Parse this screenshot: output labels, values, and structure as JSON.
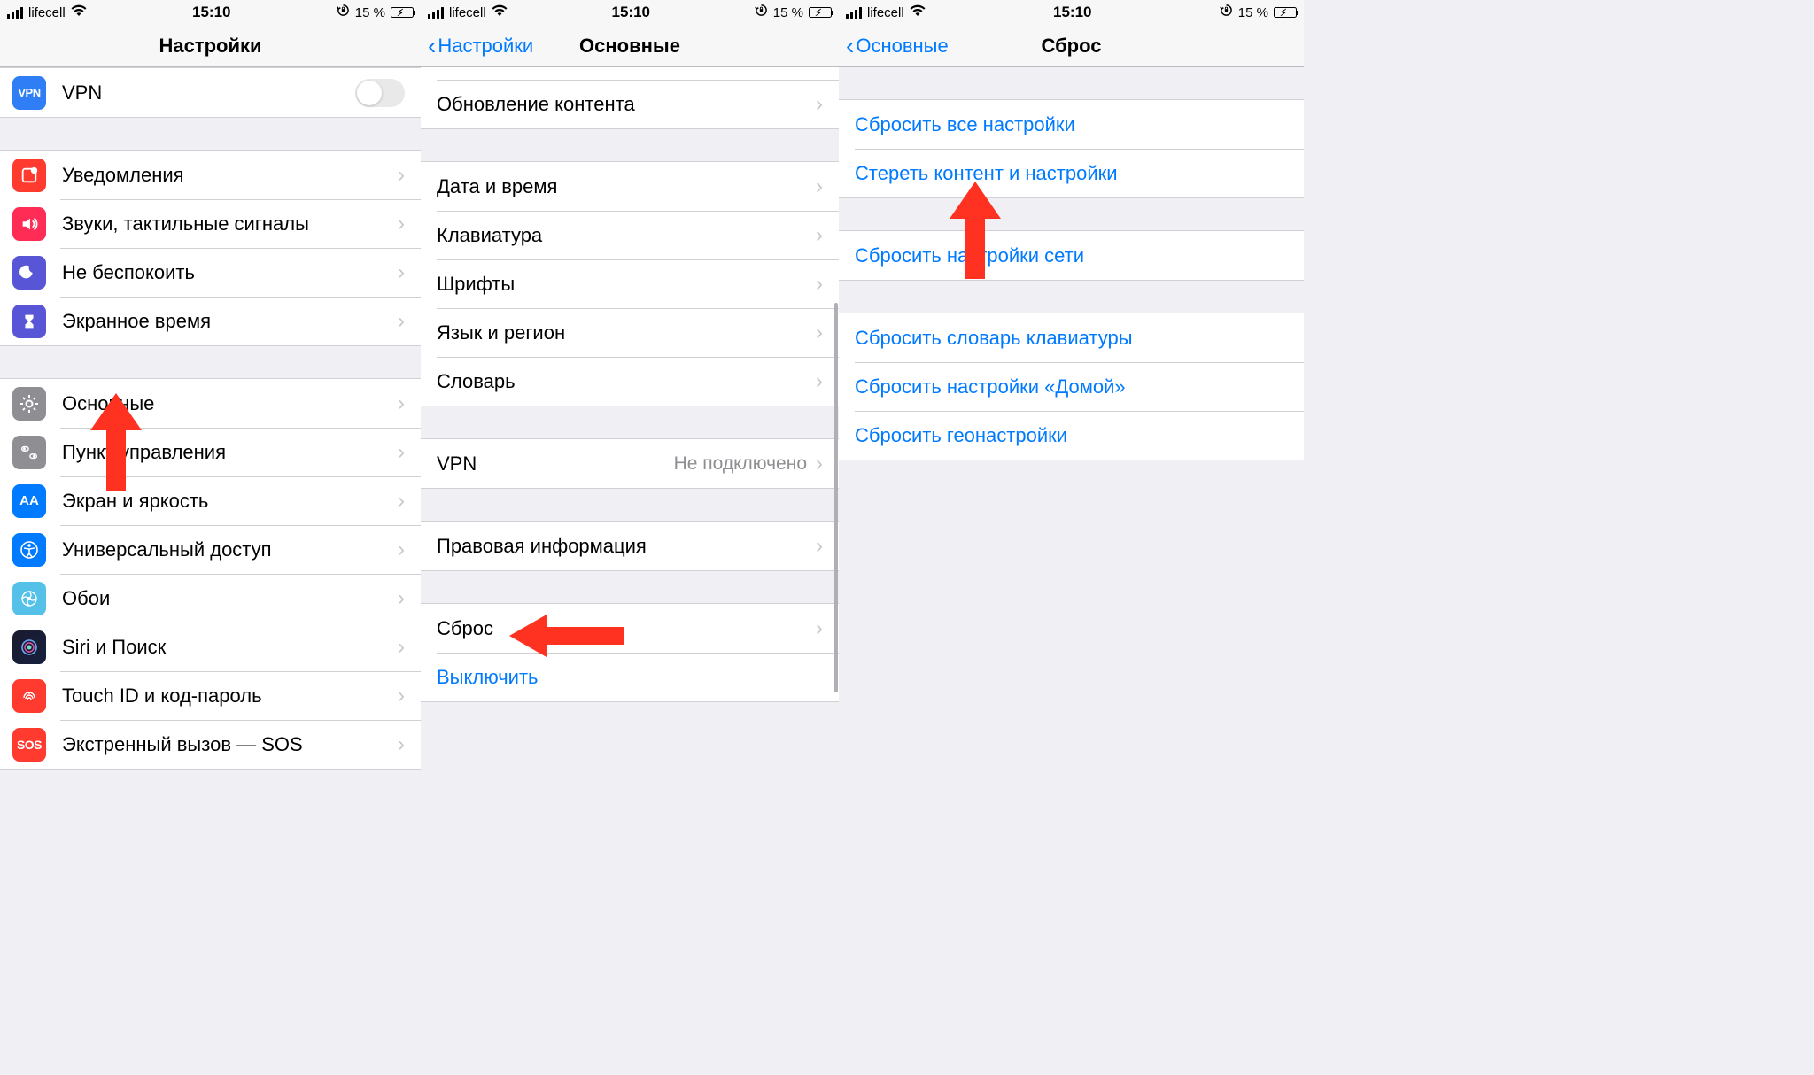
{
  "status": {
    "carrier": "lifecell",
    "time": "15:10",
    "battery_pct": "15 %"
  },
  "screen1": {
    "title": "Настройки",
    "rows": {
      "vpn": "VPN",
      "notifications": "Уведомления",
      "sounds": "Звуки, тактильные сигналы",
      "dnd": "Не беспокоить",
      "screentime": "Экранное время",
      "general": "Основные",
      "control": "Пункт управления",
      "display": "Экран и яркость",
      "accessibility": "Универсальный доступ",
      "wallpaper": "Обои",
      "siri": "Siri и Поиск",
      "touchid": "Touch ID и код-пароль",
      "sos": "Экстренный вызов — SOS"
    }
  },
  "screen2": {
    "back": "Настройки",
    "title": "Основные",
    "rows": {
      "refresh": "Обновление контента",
      "datetime": "Дата и время",
      "keyboard": "Клавиатура",
      "fonts": "Шрифты",
      "lang": "Язык и регион",
      "dictionary": "Словарь",
      "vpn": "VPN",
      "vpn_value": "Не подключено",
      "legal": "Правовая информация",
      "reset": "Сброс",
      "shutdown": "Выключить"
    }
  },
  "screen3": {
    "back": "Основные",
    "title": "Сброс",
    "rows": {
      "all_settings": "Сбросить все настройки",
      "erase": "Стереть контент и настройки",
      "network": "Сбросить настройки сети",
      "keyboard_dict": "Сбросить словарь клавиатуры",
      "home": "Сбросить настройки «Домой»",
      "geo": "Сбросить геонастройки"
    }
  }
}
